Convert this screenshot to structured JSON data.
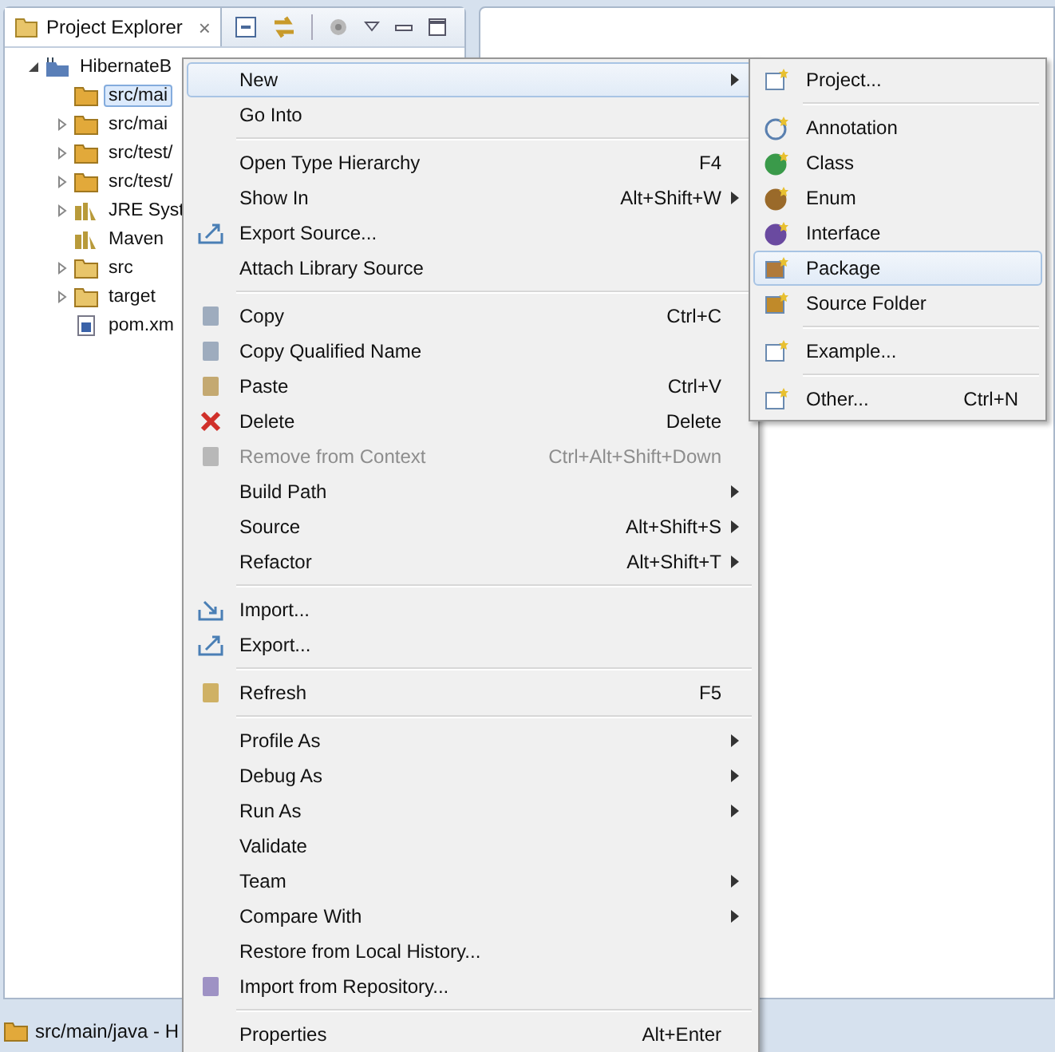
{
  "view": {
    "title": "Project Explorer",
    "close": "×"
  },
  "tree": [
    {
      "label": "HibernateB",
      "expanded": true,
      "selected": false,
      "children": [
        {
          "label": "src/mai",
          "expandable": false,
          "selected": true
        },
        {
          "label": "src/mai",
          "expandable": true,
          "selected": false
        },
        {
          "label": "src/test/",
          "expandable": true,
          "selected": false
        },
        {
          "label": "src/test/",
          "expandable": true,
          "selected": false
        },
        {
          "label": "JRE Syst",
          "expandable": true,
          "selected": false
        },
        {
          "label": "Maven",
          "expandable": false,
          "selected": false
        },
        {
          "label": "src",
          "expandable": true,
          "selected": false
        },
        {
          "label": "target",
          "expandable": true,
          "selected": false
        },
        {
          "label": "pom.xm",
          "expandable": false,
          "selected": false
        }
      ]
    }
  ],
  "status_bar": {
    "text": "src/main/java - H"
  },
  "context_menu": [
    {
      "kind": "item",
      "label": "New",
      "submenu": true,
      "selected": true
    },
    {
      "kind": "item",
      "label": "Go Into",
      "selected": false
    },
    {
      "kind": "separator"
    },
    {
      "kind": "item",
      "label": "Open Type Hierarchy",
      "shortcut": "F4",
      "selected": false
    },
    {
      "kind": "item",
      "label": "Show In",
      "shortcut": "Alt+Shift+W",
      "submenu": true,
      "selected": false
    },
    {
      "kind": "item",
      "label": "Export Source...",
      "selected": false
    },
    {
      "kind": "item",
      "label": "Attach Library Source",
      "selected": false
    },
    {
      "kind": "separator"
    },
    {
      "kind": "item",
      "label": "Copy",
      "shortcut": "Ctrl+C",
      "selected": false
    },
    {
      "kind": "item",
      "label": "Copy Qualified Name",
      "selected": false
    },
    {
      "kind": "item",
      "label": "Paste",
      "shortcut": "Ctrl+V",
      "selected": false
    },
    {
      "kind": "item",
      "label": "Delete",
      "shortcut": "Delete",
      "selected": false
    },
    {
      "kind": "item",
      "label": "Remove from Context",
      "shortcut": "Ctrl+Alt+Shift+Down",
      "disabled": true,
      "selected": false
    },
    {
      "kind": "item",
      "label": "Build Path",
      "submenu": true,
      "selected": false
    },
    {
      "kind": "item",
      "label": "Source",
      "shortcut": "Alt+Shift+S",
      "submenu": true,
      "selected": false
    },
    {
      "kind": "item",
      "label": "Refactor",
      "shortcut": "Alt+Shift+T",
      "submenu": true,
      "selected": false
    },
    {
      "kind": "separator"
    },
    {
      "kind": "item",
      "label": "Import...",
      "selected": false
    },
    {
      "kind": "item",
      "label": "Export...",
      "selected": false
    },
    {
      "kind": "separator"
    },
    {
      "kind": "item",
      "label": "Refresh",
      "shortcut": "F5",
      "selected": false
    },
    {
      "kind": "separator"
    },
    {
      "kind": "item",
      "label": "Profile As",
      "submenu": true,
      "selected": false
    },
    {
      "kind": "item",
      "label": "Debug As",
      "submenu": true,
      "selected": false
    },
    {
      "kind": "item",
      "label": "Run As",
      "submenu": true,
      "selected": false
    },
    {
      "kind": "item",
      "label": "Validate",
      "selected": false
    },
    {
      "kind": "item",
      "label": "Team",
      "submenu": true,
      "selected": false
    },
    {
      "kind": "item",
      "label": "Compare With",
      "submenu": true,
      "selected": false
    },
    {
      "kind": "item",
      "label": "Restore from Local History...",
      "selected": false
    },
    {
      "kind": "item",
      "label": "Import from Repository...",
      "selected": false
    },
    {
      "kind": "separator"
    },
    {
      "kind": "item",
      "label": "Properties",
      "shortcut": "Alt+Enter",
      "selected": false
    }
  ],
  "submenu": [
    {
      "kind": "item",
      "label": "Project...",
      "selected": false
    },
    {
      "kind": "separator"
    },
    {
      "kind": "item",
      "label": "Annotation",
      "selected": false
    },
    {
      "kind": "item",
      "label": "Class",
      "selected": false
    },
    {
      "kind": "item",
      "label": "Enum",
      "selected": false
    },
    {
      "kind": "item",
      "label": "Interface",
      "selected": false
    },
    {
      "kind": "item",
      "label": "Package",
      "selected": true
    },
    {
      "kind": "item",
      "label": "Source Folder",
      "selected": false
    },
    {
      "kind": "separator"
    },
    {
      "kind": "item",
      "label": "Example...",
      "selected": false
    },
    {
      "kind": "separator"
    },
    {
      "kind": "item",
      "label": "Other...",
      "shortcut": "Ctrl+N",
      "selected": false
    }
  ]
}
